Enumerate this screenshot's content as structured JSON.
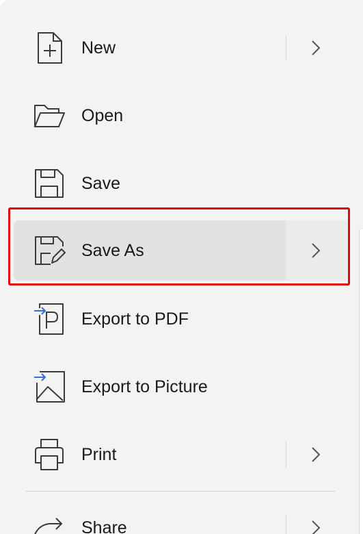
{
  "menu": {
    "items": [
      {
        "label": "New",
        "icon": "new-document-icon",
        "submenu": true
      },
      {
        "label": "Open",
        "icon": "folder-open-icon",
        "submenu": false
      },
      {
        "label": "Save",
        "icon": "save-icon",
        "submenu": false
      },
      {
        "label": "Save As",
        "icon": "save-as-icon",
        "submenu": true,
        "hovered": true,
        "highlighted": true
      },
      {
        "label": "Export to PDF",
        "icon": "export-pdf-icon",
        "submenu": false
      },
      {
        "label": "Export to Picture",
        "icon": "export-picture-icon",
        "submenu": false
      },
      {
        "label": "Print",
        "icon": "printer-icon",
        "submenu": true
      },
      {
        "label": "Share",
        "icon": "share-icon",
        "submenu": true
      }
    ]
  },
  "colors": {
    "menu_background": "#f3f3f3",
    "hover_background": "#e2e2e2",
    "highlight_border": "#e0080d",
    "icon_accent": "#2f6fd6",
    "text": "#1a1a1a"
  }
}
